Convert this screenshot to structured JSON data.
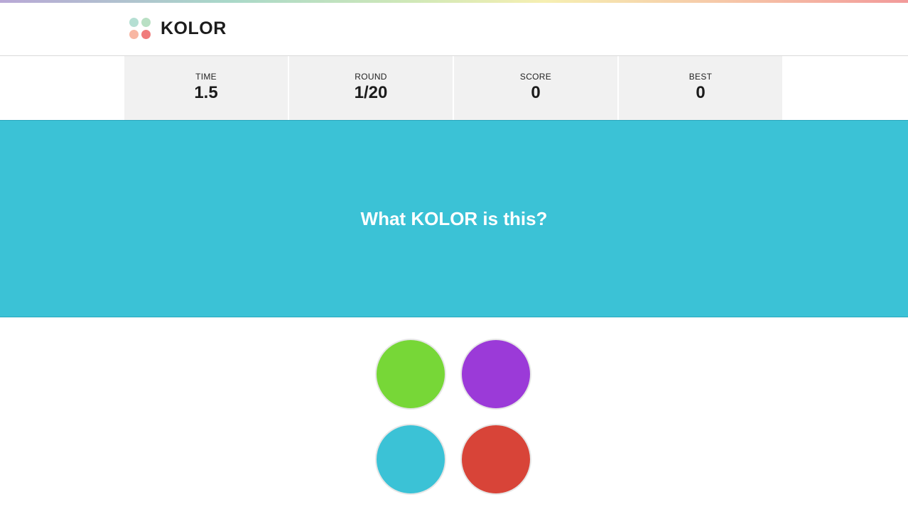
{
  "app": {
    "name": "KOLOR",
    "logo_colors": [
      "#b5dfd3",
      "#b9e0c4",
      "#f8b7a3",
      "#f07c7c"
    ]
  },
  "stats": [
    {
      "label": "TIME",
      "value": "1.5"
    },
    {
      "label": "ROUND",
      "value": "1/20"
    },
    {
      "label": "SCORE",
      "value": "0"
    },
    {
      "label": "BEST",
      "value": "0"
    }
  ],
  "prompt": {
    "before": "What ",
    "keyword": "KOLOR",
    "after": " is this?",
    "background_color": "#3bc2d6"
  },
  "choices": [
    {
      "color": "#77d737"
    },
    {
      "color": "#9b3ad8"
    },
    {
      "color": "#3bc2d6"
    },
    {
      "color": "#d84438"
    }
  ]
}
